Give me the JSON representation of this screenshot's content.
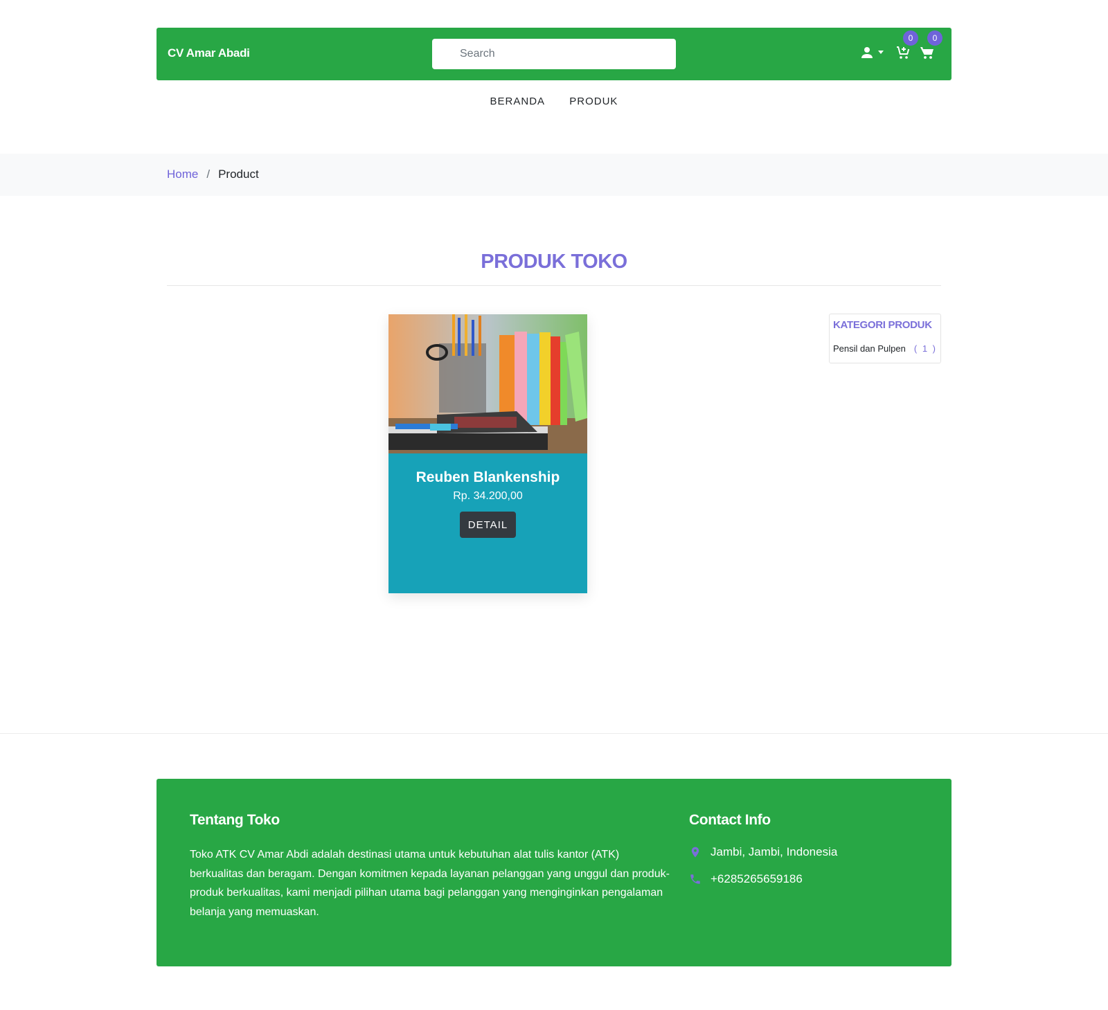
{
  "header": {
    "brand": "CV Amar Abadi",
    "search_placeholder": "Search",
    "wishlist_count": "0",
    "cart_count": "0"
  },
  "nav": {
    "items": [
      {
        "label": "BERANDA"
      },
      {
        "label": "PRODUK"
      }
    ]
  },
  "breadcrumb": {
    "home": "Home",
    "separator": "/",
    "current": "Product"
  },
  "section": {
    "title": "PRODUK TOKO"
  },
  "products": [
    {
      "name": "Reuben Blankenship",
      "price": "Rp. 34.200,00",
      "button": "DETAIL",
      "image": "stationery-photo"
    }
  ],
  "categories": {
    "title": "KATEGORI PRODUK",
    "items": [
      {
        "label": "Pensil dan Pulpen",
        "count": "( 1 )"
      }
    ]
  },
  "footer": {
    "about_title": "Tentang Toko",
    "about_text": "Toko ATK CV Amar Abdi adalah destinasi utama untuk kebutuhan alat tulis kantor (ATK) berkualitas dan beragam. Dengan komitmen kepada layanan pelanggan yang unggul dan produk-produk berkualitas, kami menjadi pilihan utama bagi pelanggan yang menginginkan pengalaman belanja yang memuaskan.",
    "contact_title": "Contact Info",
    "address": "Jambi, Jambi, Indonesia",
    "phone": "+6285265659186"
  },
  "colors": {
    "brand_green": "#28a745",
    "accent_purple": "#7a6fd9",
    "card_teal": "#17a2b8",
    "dark_button": "#343a40"
  }
}
